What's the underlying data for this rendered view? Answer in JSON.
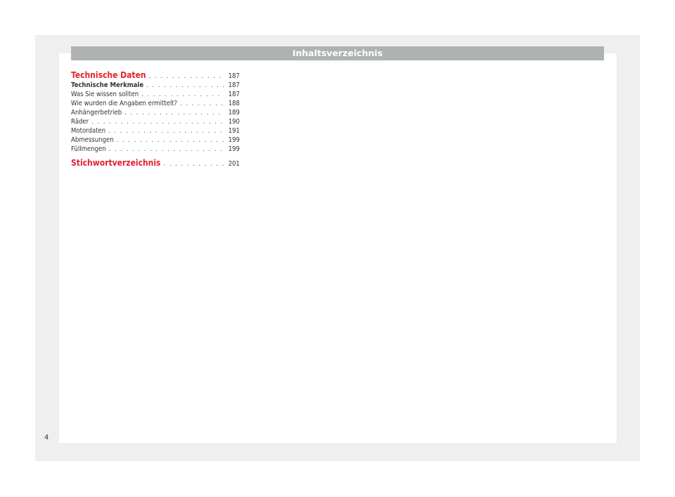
{
  "header": {
    "title": "Inhaltsverzeichnis"
  },
  "toc": {
    "chapter1": {
      "label": "Technische Daten",
      "page": "187"
    },
    "entries": [
      {
        "label": "Technische Merkmale",
        "page": "187"
      },
      {
        "label": "Was Sie wissen sollten",
        "page": "187"
      },
      {
        "label": "Wie wurden die Angaben ermittelt?",
        "page": "188"
      },
      {
        "label": "Anhängerbetrieb",
        "page": "189"
      },
      {
        "label": "Räder",
        "page": "190"
      },
      {
        "label": "Motordaten",
        "page": "191"
      },
      {
        "label": "Abmessungen",
        "page": "199"
      },
      {
        "label": "Füllmengen",
        "page": "199"
      }
    ],
    "chapter2": {
      "label": "Stichwortverzeichnis",
      "page": "201"
    }
  },
  "footer": {
    "page_number": "4"
  },
  "colors": {
    "accent": "#e3212e",
    "header_bar": "#aeb3b0",
    "frame": "#efefef"
  }
}
